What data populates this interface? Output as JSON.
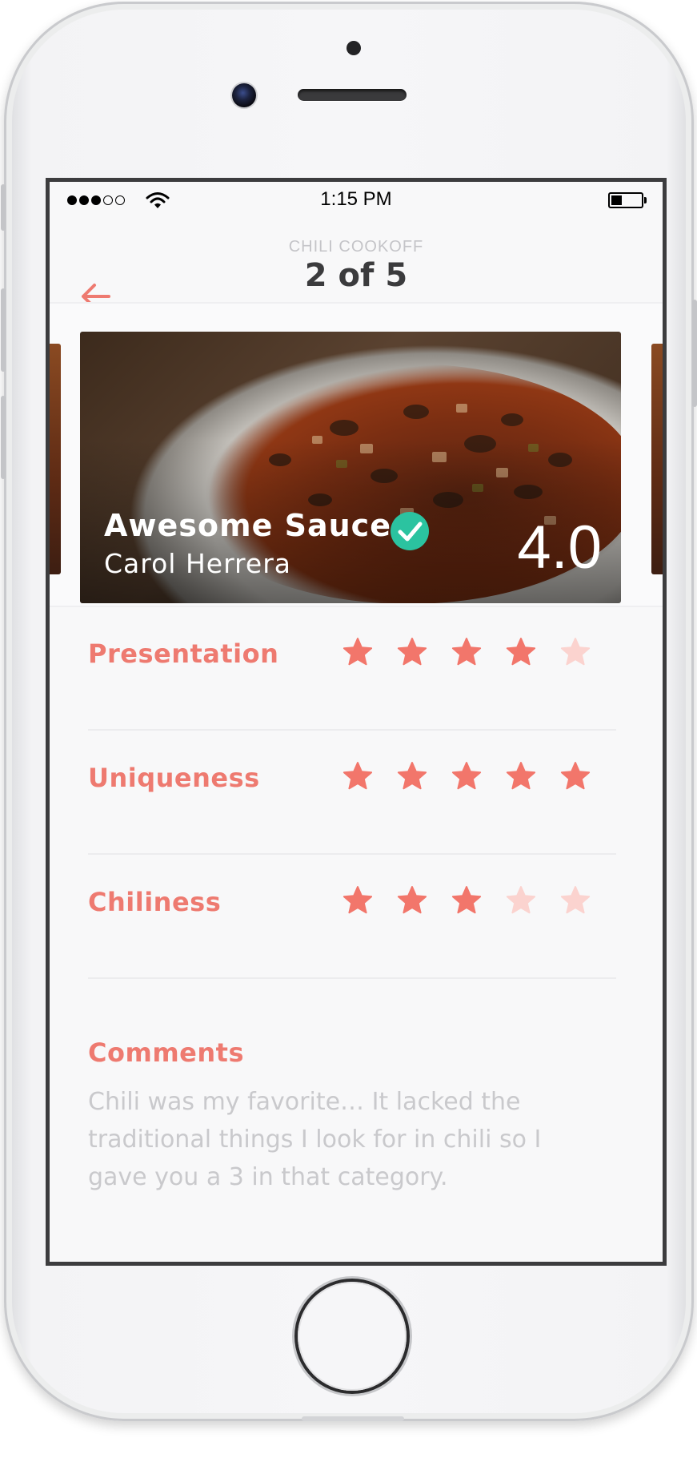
{
  "status_bar": {
    "time": "1:15 PM",
    "signal_bars_filled": 3,
    "signal_bars_total": 5,
    "battery_level": 0.35
  },
  "nav": {
    "subtitle": "CHILI COOKOFF",
    "title": "2 of 5",
    "back_icon": "back-arrow-icon"
  },
  "entry": {
    "dish_name": "Awesome Sauce",
    "chef_name": "Carol Herrera",
    "score": "4.0",
    "verified": true
  },
  "ratings": [
    {
      "label": "Presentation",
      "value": 4,
      "max": 5
    },
    {
      "label": "Uniqueness",
      "value": 5,
      "max": 5
    },
    {
      "label": "Chiliness",
      "value": 3,
      "max": 5
    }
  ],
  "comments": {
    "label": "Comments",
    "text": "Chili was my favorite… It lacked the traditional things I look for in chili so I gave you a 3 in that category."
  },
  "colors": {
    "accent": "#ee7a70",
    "star_filled": "#f2766b",
    "star_empty": "#fbd3cf",
    "verified": "#2bc3a0",
    "title": "#3b3b3d",
    "muted": "#c9c9cc"
  }
}
